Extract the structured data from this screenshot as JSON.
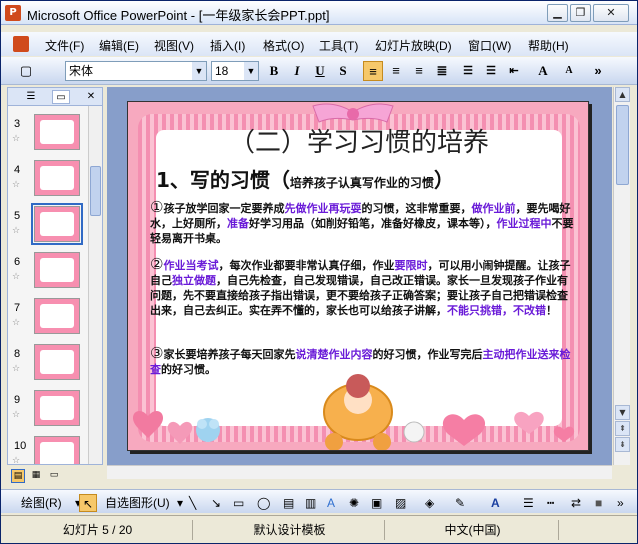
{
  "window": {
    "title": "Microsoft Office PowerPoint - [一年级家长会PPT.ppt]",
    "app_icon": "powerpoint-icon",
    "controls": [
      "minimize-icon",
      "restore-icon",
      "close-icon"
    ]
  },
  "menubar": {
    "items": [
      "文件(F)",
      "编辑(E)",
      "视图(V)",
      "插入(I)",
      "格式(O)",
      "工具(T)",
      "幻灯片放映(D)",
      "窗口(W)",
      "帮助(H)"
    ]
  },
  "toolbar": {
    "font_name": "宋体",
    "font_size": "18",
    "bold": "B",
    "italic": "I",
    "underline": "U",
    "shadow": "S",
    "font_grow": "A",
    "font_shrink": "A"
  },
  "thumbnails": {
    "slides": [
      "3",
      "4",
      "5",
      "6",
      "7",
      "8",
      "9",
      "10"
    ],
    "selected": "5"
  },
  "slide": {
    "title": "（二）学习习惯的培养",
    "heading": "1、写的习惯（",
    "heading_sub": "培养孩子认真写作业的习惯",
    "heading_close": "）",
    "p1": {
      "num": "①",
      "t1": "孩子放学回家一定要养成",
      "h1": "先做作业再玩耍",
      "t2": "的习惯，这非常重要，",
      "h2": "做作业前",
      "t3": "，要先喝好水，上好厕所，",
      "h3": "准备",
      "t4": "好学习用品（如削好铅笔，准备好橡皮，课本等），",
      "h4": "作业过程中",
      "t5": "不要轻易离开书桌。"
    },
    "p2": {
      "num": "②",
      "h1": "作业当考试",
      "t1": "，每次作业都要非常认真仔细，作业",
      "h2": "要限时",
      "t2": "，可以用小闹钟提醒。让孩子自己",
      "h3": "独立做题",
      "t3": "，自己先检查，自己发现错误，自己改正错误。家长一旦发现孩子作业有问题，先不要直接给孩子指出错误，更不要给孩子正确答案；要让孩子自己把错误检查出来，自己去纠正。实在弄不懂的，家长也可以给孩子讲解，",
      "h4": "不能只挑错，不改错",
      "t4": "！"
    },
    "p3": {
      "num": "③",
      "t1": "家长要培养孩子每天回家先",
      "h1": "说清楚作业内容",
      "t2": "的好习惯，作业写完后",
      "h2": "主动把作业送来检查",
      "t3": "的好习惯。"
    },
    "colors": {
      "accent_text": "#6a1bd8",
      "frame_pink": "#f48fb1",
      "background_pink": "#f7a9bf"
    }
  },
  "drawbar": {
    "draw_label": "绘图(R)",
    "autoshapes_label": "自选图形(U)"
  },
  "statusbar": {
    "slide_info": "幻灯片 5 / 20",
    "template": "默认设计模板",
    "language": "中文(中国)"
  }
}
